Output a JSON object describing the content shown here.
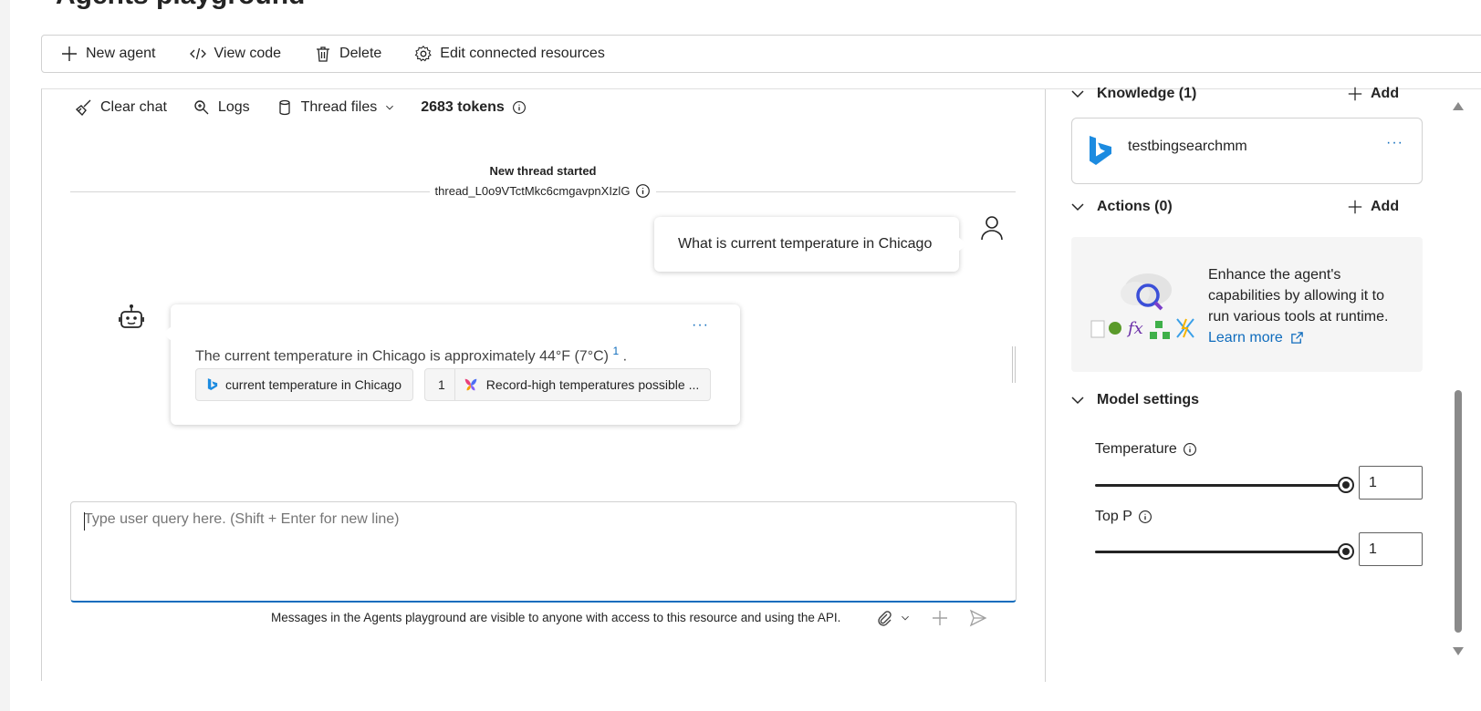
{
  "page": {
    "title": "Agents playground"
  },
  "toolbar": {
    "new_agent": "New agent",
    "view_code": "View code",
    "delete": "Delete",
    "edit_resources": "Edit connected resources"
  },
  "chat_toolbar": {
    "clear_chat": "Clear chat",
    "logs": "Logs",
    "thread_files": "Thread files",
    "tokens": "2683 tokens"
  },
  "thread": {
    "title": "New thread started",
    "id": "thread_L0o9VTctMkc6cmgavpnXIzlG"
  },
  "messages": {
    "user": "What is current temperature in Chicago",
    "bot_text": "The current temperature in Chicago is approximately 44°F (7°C)",
    "bot_citation": "1",
    "bot_period": ".",
    "chip_search": "current temperature in Chicago",
    "chip_ref_num": "1",
    "chip_ref_title": "Record-high temperatures possible ..."
  },
  "composer": {
    "placeholder": "Type user query here. (Shift + Enter for new line)",
    "disclaimer": "Messages in the Agents playground are visible to anyone with access to this resource and using the API."
  },
  "panel": {
    "knowledge_header": "Knowledge (1)",
    "add_label": "Add",
    "knowledge_item": "testbingsearchmm",
    "actions_header": "Actions (0)",
    "actions_desc": "Enhance the agent's capabilities by allowing it to run various tools at runtime.",
    "learn_more": "Learn more",
    "model_settings_header": "Model settings",
    "temperature_label": "Temperature",
    "temperature_value": "1",
    "temperature_level": 1.0,
    "top_p_label": "Top P",
    "top_p_value": "1",
    "top_p_level": 1.0
  },
  "colors": {
    "accent": "#0f6cbd",
    "border": "#d1d1d1",
    "bing_blue": "#1c8be0"
  }
}
